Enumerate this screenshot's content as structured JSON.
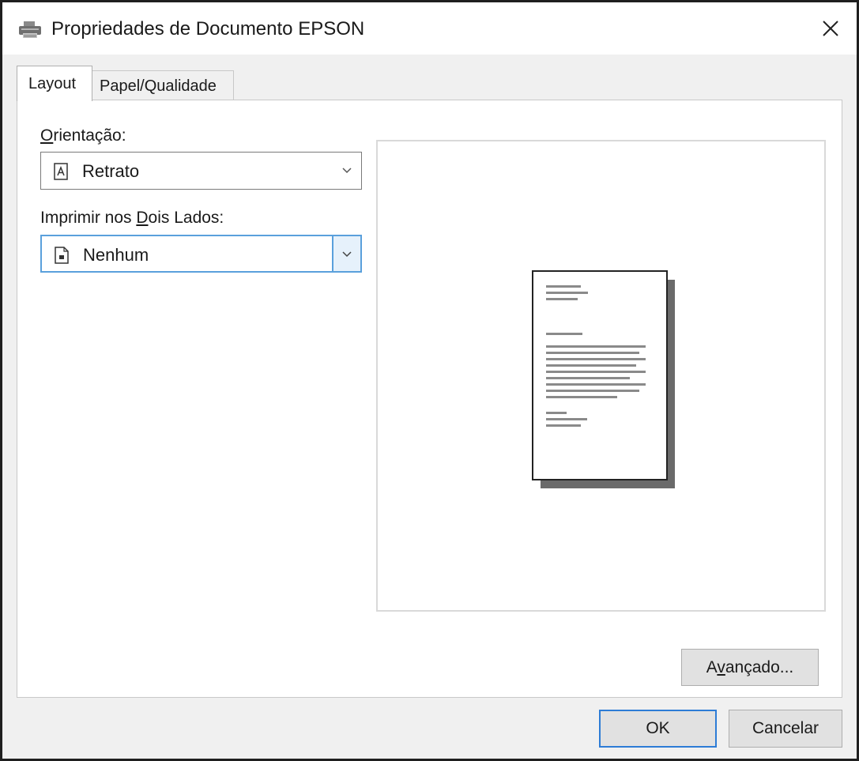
{
  "window": {
    "title": "Propriedades de Documento EPSON"
  },
  "tabs": [
    {
      "label": "Layout",
      "active": true
    },
    {
      "label": "Papel/Qualidade",
      "active": false
    }
  ],
  "orientation": {
    "label_mnemonic": "O",
    "label_rest": "rientação:",
    "value": "Retrato"
  },
  "duplex": {
    "label_pre": "Imprimir nos ",
    "label_mnemonic": "D",
    "label_post": "ois Lados:",
    "value": "Nenhum"
  },
  "buttons": {
    "advanced_pre": "A",
    "advanced_mnemonic": "v",
    "advanced_post": "ançado...",
    "ok": "OK",
    "cancel": "Cancelar"
  },
  "icons": {
    "title": "printer-icon",
    "close": "close-icon",
    "orientation": "portrait-document-icon",
    "duplex": "document-icon",
    "dropdown": "chevron-down-icon"
  },
  "colors": {
    "focus_border": "#5aa0dc",
    "default_button_border": "#2d7cd6",
    "dialog_background": "#f0f0f0"
  }
}
